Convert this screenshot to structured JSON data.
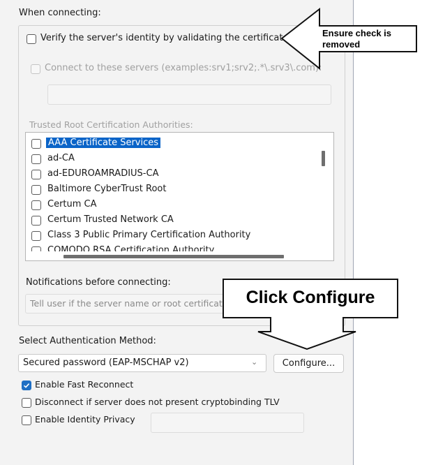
{
  "when_connecting": {
    "heading": "When connecting:",
    "verify_label": "Verify the server's identity by validating the certificate",
    "verify_checked": false,
    "connect_servers_label": "Connect to these servers (examples:srv1;srv2;.*\\.srv3\\.com):",
    "connect_servers_value": "",
    "trusted_root_heading": "Trusted Root Certification Authorities:",
    "trusted_root_items": [
      {
        "label": "AAA Certificate Services",
        "selected": true
      },
      {
        "label": "ad-CA"
      },
      {
        "label": "ad-EDUROAMRADIUS-CA"
      },
      {
        "label": "Baltimore CyberTrust Root"
      },
      {
        "label": "Certum CA"
      },
      {
        "label": "Certum Trusted Network CA"
      },
      {
        "label": "Class 3 Public Primary Certification Authority"
      },
      {
        "label": "COMODO RSA Certification Authority"
      }
    ],
    "notifications_heading": "Notifications before connecting:",
    "notifications_value": "Tell user if the server name or root certificate isn't specified"
  },
  "auth": {
    "heading": "Select Authentication Method:",
    "method_value": "Secured password (EAP-MSCHAP v2)",
    "configure_button": "Configure...",
    "fast_reconnect_label": "Enable Fast Reconnect",
    "fast_reconnect_checked": true,
    "disconnect_label": "Disconnect if server does not present cryptobinding TLV",
    "disconnect_checked": false,
    "identity_privacy_label": "Enable Identity Privacy",
    "identity_privacy_checked": false,
    "identity_privacy_value": ""
  },
  "annotations": {
    "arrow_left_text_line1": "Ensure check is",
    "arrow_left_text_line2": "removed",
    "arrow_down_text": "Click Configure"
  },
  "colors": {
    "selection": "#0a64c8",
    "checked_box": "#1f6fc4",
    "dialog_bg": "#f3f3f3"
  }
}
